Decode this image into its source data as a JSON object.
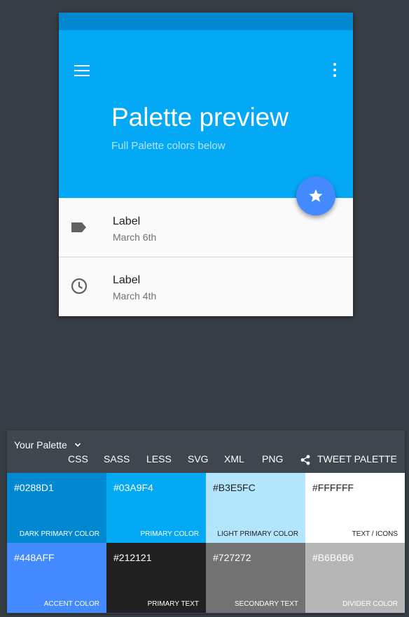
{
  "preview": {
    "title": "Palette preview",
    "subtitle": "Full Palette colors below",
    "menu_icon": "menu-icon",
    "more_icon": "more-vert-icon",
    "fab_icon": "star-icon",
    "list": [
      {
        "icon": "label-icon",
        "label": "Label",
        "date": "March 6th"
      },
      {
        "icon": "clock-icon",
        "label": "Label",
        "date": "March 4th"
      }
    ]
  },
  "palette": {
    "title": "Your Palette",
    "tabs": [
      "CSS",
      "SASS",
      "LESS",
      "SVG",
      "XML",
      "PNG"
    ],
    "tweet_label": "TWEET PALETTE",
    "swatches": [
      {
        "hex": "#0288D1",
        "role": "DARK PRIMARY COLOR",
        "bg": "#0288D1",
        "fg": "#FFFFFF"
      },
      {
        "hex": "#03A9F4",
        "role": "PRIMARY COLOR",
        "bg": "#03A9F4",
        "fg": "#FFFFFF"
      },
      {
        "hex": "#B3E5FC",
        "role": "LIGHT PRIMARY COLOR",
        "bg": "#B3E5FC",
        "fg": "#212121"
      },
      {
        "hex": "#FFFFFF",
        "role": "TEXT / ICONS",
        "bg": "#FFFFFF",
        "fg": "#212121"
      },
      {
        "hex": "#448AFF",
        "role": "ACCENT COLOR",
        "bg": "#448AFF",
        "fg": "#FFFFFF"
      },
      {
        "hex": "#212121",
        "role": "PRIMARY TEXT",
        "bg": "#212121",
        "fg": "#FFFFFF"
      },
      {
        "hex": "#727272",
        "role": "SECONDARY TEXT",
        "bg": "#727272",
        "fg": "#FFFFFF"
      },
      {
        "hex": "#B6B6B6",
        "role": "DIVIDER COLOR",
        "bg": "#B6B6B6",
        "fg": "#FFFFFF"
      }
    ]
  }
}
